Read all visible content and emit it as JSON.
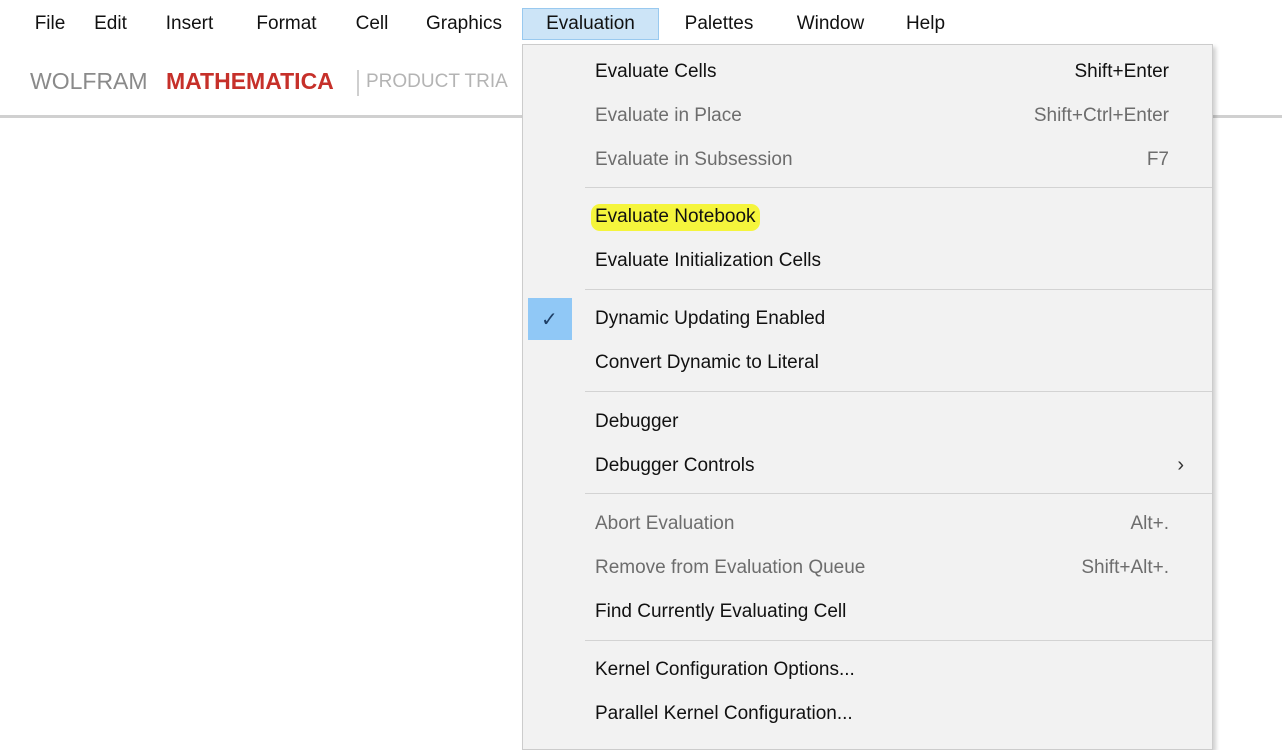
{
  "menubar": {
    "items": [
      "File",
      "Edit",
      "Insert",
      "Format",
      "Cell",
      "Graphics",
      "Evaluation",
      "Palettes",
      "Window",
      "Help"
    ],
    "active": "Evaluation"
  },
  "brand": {
    "wolfram": "WOLFRAM",
    "mathematica": "MATHEMATICA",
    "trial": "PRODUCT TRIA"
  },
  "menu": {
    "items": [
      {
        "label": "Evaluate Cells",
        "shortcut": "Shift+Enter",
        "enabled": true
      },
      {
        "label": "Evaluate in Place",
        "shortcut": "Shift+Ctrl+Enter",
        "enabled": false
      },
      {
        "label": "Evaluate in Subsession",
        "shortcut": "F7",
        "enabled": false
      },
      {
        "label": "Evaluate Notebook",
        "shortcut": "",
        "enabled": true,
        "highlighted": true
      },
      {
        "label": "Evaluate Initialization Cells",
        "shortcut": "",
        "enabled": true
      },
      {
        "label": "Dynamic Updating Enabled",
        "shortcut": "",
        "enabled": true,
        "checked": true
      },
      {
        "label": "Convert Dynamic to Literal",
        "shortcut": "",
        "enabled": true
      },
      {
        "label": "Debugger",
        "shortcut": "",
        "enabled": true
      },
      {
        "label": "Debugger Controls",
        "shortcut": "",
        "enabled": true,
        "submenu": true
      },
      {
        "label": "Abort Evaluation",
        "shortcut": "Alt+.",
        "enabled": false
      },
      {
        "label": "Remove from Evaluation Queue",
        "shortcut": "Shift+Alt+.",
        "enabled": false
      },
      {
        "label": "Find Currently Evaluating Cell",
        "shortcut": "",
        "enabled": true
      },
      {
        "label": "Kernel Configuration Options...",
        "shortcut": "",
        "enabled": true
      },
      {
        "label": "Parallel Kernel Configuration...",
        "shortcut": "",
        "enabled": true
      }
    ],
    "highlight_color": "#f5f53c",
    "check_color": "#90c8f6"
  }
}
